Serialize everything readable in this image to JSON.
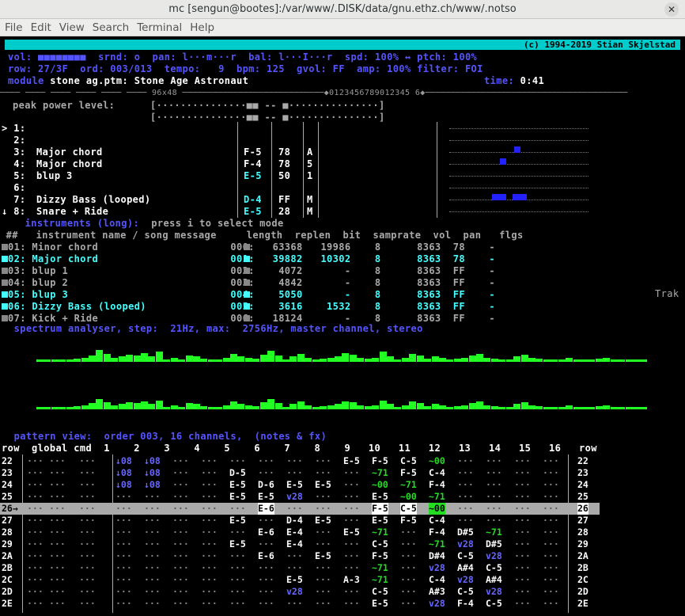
{
  "window": {
    "title": "mc [sengun@bootes]:/var/www/.DISK/data/gnu.ethz.ch/www/.notso"
  },
  "menu": [
    "File",
    "Edit",
    "View",
    "Search",
    "Terminal",
    "Help"
  ],
  "banner": {
    "left": " opencp v0.2.0",
    "right": "(c) 1994-2019 Stian Skjelstad"
  },
  "status": {
    "line1": "vol: ■■■■■■■■  srnd: o  pan: l···m···r  bal: l···I···r  spd: 100% ↔ ptch: 100%",
    "line2": "row: 27/3F  ord: 003/013  tempo:   9  bpm: 125  gvol: FF  amp: 100% filter: FOI",
    "module_label": "module ",
    "module_file": "stone ag.ptm:",
    "module_title": " Stone Age Astronaut",
    "time_label": "time:",
    "time_value": " 0:41"
  },
  "divider": "──── ──── ──── ──── ──── ──── 96x48 ────────────────────────────◆0123456789012345 6◆────────────────────────────────────────",
  "peak": {
    "label": "peak power level:",
    "line1": "[···············■■ -- ■···············]",
    "line2": "[···············■■ -- ■···············]"
  },
  "channels": [
    {
      "num": "> 1:",
      "name": "",
      "note": "",
      "vol": "",
      "fx": ""
    },
    {
      "num": "  2:",
      "name": "",
      "note": "",
      "vol": "",
      "fx": ""
    },
    {
      "num": "  3:",
      "name": "Major chord",
      "note": "F-5",
      "vol": "78",
      "fx": "A"
    },
    {
      "num": "  4:",
      "name": "Major chord",
      "note": "F-4",
      "vol": "78",
      "fx": "5"
    },
    {
      "num": "  5:",
      "name": "blup 3",
      "note": "E-5",
      "vol": "50",
      "fx": "1"
    },
    {
      "num": "  6:",
      "name": "",
      "note": "",
      "vol": "",
      "fx": ""
    },
    {
      "num": "  7:",
      "name": "Dizzy Bass (looped)",
      "note": "D-4",
      "vol": "FF",
      "fx": "M"
    },
    {
      "num": "↓ 8:",
      "name": "Snare + Ride",
      "note": "E-5",
      "vol": "28",
      "fx": "M"
    }
  ],
  "instruments": {
    "header_title": " instruments (long):",
    "header_hint": "  press i to select mode",
    "columns": " ##   instrument name / song message     length  replen  bit  samprate  vol  pan   flgs",
    "rows": [
      {
        "text": "01: Minor chord                      000:   63368   19986    8      8363  78    -",
        "cls": "g"
      },
      {
        "text": "02: Major chord                      001:   39882   10302    8      8363  78    -",
        "cls": "c"
      },
      {
        "text": "03: blup 1                           002:    4072       -    8      8363  FF    -",
        "cls": "g"
      },
      {
        "text": "04: blup 2                           003:    4842       -    8      8363  FF    -",
        "cls": "g"
      },
      {
        "text": "05: blup 3                           004:    5050       -    8      8363  FF    -",
        "cls": "c"
      },
      {
        "text": "06: Dizzy Bass (looped)              005:    3616    1532    8      8363  FF    -",
        "cls": "c"
      },
      {
        "text": "07: Kick + Ride                      006:   18124       -    8      8363  FF    -",
        "cls": "g"
      }
    ]
  },
  "spectrum": {
    "title": " spectrum analyser, step:  21Hz, max:  2756Hz, master channel, stereo"
  },
  "side_text": "Trak",
  "pattern": {
    "title": " pattern view:  order 003, 16 channels,  (notes & fx)",
    "header": "row  global cmd  1    2    3    4    5    6    7    8    9   10   11   12   13   14   15   16   row",
    "rows": [
      {
        "n": "22",
        "cells": [
          "···",
          "···",
          "···",
          "↓08",
          "↓08",
          "···",
          "···",
          "···",
          "···",
          "···",
          "···",
          "E-5",
          "F-5",
          "C-5",
          "~00",
          "···",
          "···",
          "···",
          "···"
        ]
      },
      {
        "n": "23",
        "cells": [
          "···",
          "···",
          "···",
          "↓08",
          "↓08",
          "···",
          "···",
          "D-5",
          "···",
          "···",
          "···",
          "···",
          "~71",
          "F-5",
          "C-4",
          "···",
          "···",
          "···",
          "···"
        ]
      },
      {
        "n": "24",
        "cells": [
          "···",
          "···",
          "···",
          "↓08",
          "↓08",
          "···",
          "···",
          "E-5",
          "D-6",
          "E-5",
          "E-5",
          "···",
          "~00",
          "~71",
          "F-4",
          "···",
          "···",
          "···",
          "···"
        ]
      },
      {
        "n": "25",
        "cells": [
          "···",
          "···",
          "···",
          "···",
          "···",
          "···",
          "···",
          "E-5",
          "E-5",
          "v28",
          "···",
          "···",
          "E-5",
          "~00",
          "~71",
          "···",
          "···",
          "···",
          "···"
        ]
      },
      {
        "n": "26",
        "cells": [
          "···",
          "···",
          "···",
          "···",
          "···",
          "···",
          "···",
          "···",
          "E-6",
          "···",
          "···",
          "···",
          "F-5",
          "C-5",
          "~00",
          "···",
          "···",
          "···",
          "···"
        ]
      },
      {
        "n": "27",
        "cells": [
          "···",
          "···",
          "···",
          "···",
          "···",
          "···",
          "···",
          "E-5",
          "···",
          "D-4",
          "E-5",
          "···",
          "E-5",
          "F-5",
          "C-4",
          "···",
          "···",
          "···",
          "···"
        ]
      },
      {
        "n": "28",
        "cells": [
          "···",
          "···",
          "···",
          "···",
          "···",
          "···",
          "···",
          "···",
          "E-6",
          "E-4",
          "···",
          "E-5",
          "~71",
          "···",
          "F-4",
          "D#5",
          "~71",
          "···",
          "···"
        ]
      },
      {
        "n": "29",
        "cells": [
          "···",
          "···",
          "···",
          "···",
          "···",
          "···",
          "···",
          "E-5",
          "···",
          "E-4",
          "···",
          "···",
          "C-5",
          "···",
          "~71",
          "v28",
          "D#5",
          "···",
          "···"
        ]
      },
      {
        "n": "2A",
        "cells": [
          "···",
          "···",
          "···",
          "···",
          "···",
          "···",
          "···",
          "···",
          "E-6",
          "···",
          "E-5",
          "···",
          "F-5",
          "···",
          "D#4",
          "C-5",
          "v28",
          "···",
          "···"
        ]
      },
      {
        "n": "2B",
        "cells": [
          "···",
          "···",
          "···",
          "···",
          "···",
          "···",
          "···",
          "···",
          "···",
          "···",
          "···",
          "···",
          "~71",
          "···",
          "v28",
          "A#4",
          "C-5",
          "···",
          "···"
        ]
      },
      {
        "n": "2C",
        "cells": [
          "···",
          "···",
          "···",
          "···",
          "···",
          "···",
          "···",
          "···",
          "···",
          "E-5",
          "···",
          "A-3",
          "~71",
          "···",
          "C-4",
          "v28",
          "A#4",
          "···",
          "···"
        ]
      },
      {
        "n": "2D",
        "cells": [
          "···",
          "···",
          "···",
          "···",
          "···",
          "···",
          "···",
          "···",
          "···",
          "v28",
          "···",
          "···",
          "C-5",
          "···",
          "A#3",
          "C-5",
          "v28",
          "···",
          "···"
        ]
      },
      {
        "n": "2E",
        "cells": [
          "···",
          "···",
          "···",
          "···",
          "···",
          "···",
          "···",
          "···",
          "···",
          "···",
          "···",
          "···",
          "E-5",
          "···",
          "v28",
          "F-4",
          "C-5",
          "···",
          "···"
        ]
      }
    ]
  },
  "spectrum_values": {
    "top": [
      0,
      0,
      0,
      0,
      0,
      1,
      2,
      4,
      10,
      6,
      2,
      3,
      5,
      4,
      7,
      3,
      8,
      0,
      2,
      0,
      4,
      3,
      1,
      0,
      0,
      2,
      6,
      3,
      2,
      1,
      5,
      9,
      4,
      0,
      3,
      6,
      2,
      0,
      1,
      2,
      3,
      7,
      5,
      2,
      1,
      2,
      8,
      3,
      0,
      2,
      6,
      4,
      1,
      3,
      2,
      0,
      1,
      2,
      4,
      6,
      2,
      1,
      0,
      0,
      3,
      5,
      2,
      1,
      0,
      0,
      0,
      2,
      0,
      0,
      0,
      1,
      2,
      0,
      0,
      0,
      0,
      0
    ],
    "bottom": [
      0,
      0,
      0,
      0,
      0,
      1,
      2,
      4,
      8,
      5,
      2,
      3,
      5,
      4,
      6,
      3,
      7,
      0,
      2,
      0,
      4,
      3,
      1,
      0,
      0,
      2,
      6,
      3,
      2,
      1,
      5,
      8,
      4,
      0,
      3,
      6,
      2,
      0,
      1,
      2,
      3,
      6,
      5,
      2,
      1,
      2,
      7,
      3,
      0,
      2,
      6,
      4,
      1,
      3,
      2,
      0,
      1,
      2,
      4,
      6,
      2,
      1,
      0,
      0,
      3,
      5,
      2,
      1,
      0,
      0,
      0,
      2,
      0,
      0,
      0,
      1,
      2,
      0,
      0,
      0,
      0,
      0
    ]
  },
  "scroller": [
    0,
    0,
    0,
    0,
    0,
    0,
    0,
    0,
    0,
    0,
    0,
    0,
    0,
    0,
    0,
    0,
    0,
    0,
    0,
    0,
    0,
    0,
    0,
    0,
    0,
    0,
    0,
    0,
    0,
    0,
    0,
    0,
    0,
    0,
    0,
    0,
    0,
    0,
    0,
    0,
    0,
    0,
    0,
    0,
    0,
    0,
    0,
    0,
    0,
    0,
    0,
    0,
    0,
    0,
    0,
    0,
    0,
    0,
    0,
    0
  ]
}
